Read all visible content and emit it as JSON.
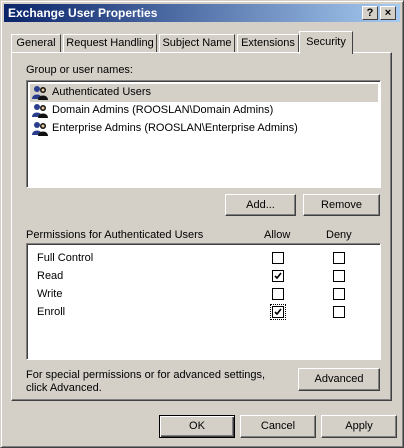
{
  "window": {
    "title": "Exchange User Properties",
    "help_glyph": "?",
    "close_glyph": "×"
  },
  "tabs": [
    {
      "label": "General"
    },
    {
      "label": "Request Handling"
    },
    {
      "label": "Subject Name"
    },
    {
      "label": "Extensions"
    },
    {
      "label": "Security",
      "active": true
    }
  ],
  "security": {
    "group_label": "Group or user names:",
    "users": [
      {
        "name": "Authenticated Users",
        "selected": true
      },
      {
        "name": "Domain Admins (ROOSLAN\\Domain Admins)"
      },
      {
        "name": "Enterprise Admins (ROOSLAN\\Enterprise Admins)"
      }
    ],
    "add_label": "Add...",
    "remove_label": "Remove",
    "permissions_label": "Permissions for Authenticated Users",
    "allow_header": "Allow",
    "deny_header": "Deny",
    "permissions": [
      {
        "name": "Full Control",
        "allow": false,
        "deny": false
      },
      {
        "name": "Read",
        "allow": true,
        "deny": false
      },
      {
        "name": "Write",
        "allow": false,
        "deny": false
      },
      {
        "name": "Enroll",
        "allow": true,
        "deny": false,
        "focused": true
      }
    ],
    "special_text_line1": "For special permissions or for advanced settings,",
    "special_text_line2": "click Advanced.",
    "advanced_label": "Advanced"
  },
  "footer": {
    "ok_label": "OK",
    "cancel_label": "Cancel",
    "apply_label": "Apply"
  },
  "colors": {
    "title_start": "#0a246a",
    "title_end": "#a6caf0",
    "face": "#d4d0c8"
  },
  "icons": {
    "user": "users-group-icon",
    "check": "checkmark-icon"
  }
}
